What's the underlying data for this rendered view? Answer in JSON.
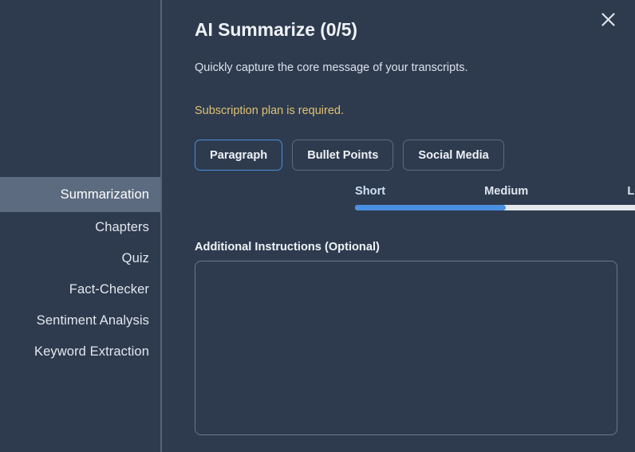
{
  "sidebar": {
    "items": [
      {
        "label": "Summarization",
        "active": true
      },
      {
        "label": "Chapters",
        "active": false
      },
      {
        "label": "Quiz",
        "active": false
      },
      {
        "label": "Fact-Checker",
        "active": false
      },
      {
        "label": "Sentiment Analysis",
        "active": false
      },
      {
        "label": "Keyword Extraction",
        "active": false
      }
    ]
  },
  "panel": {
    "title": "AI Summarize (0/5)",
    "subtitle": "Quickly capture the core message of your transcripts.",
    "notice": "Subscription plan is required.",
    "notice_color": "#e0c073",
    "close_icon": "close-icon",
    "format_options": [
      {
        "label": "Paragraph",
        "selected": true
      },
      {
        "label": "Bullet Points",
        "selected": false
      },
      {
        "label": "Social Media",
        "selected": false
      }
    ],
    "length": {
      "options": [
        {
          "label": "Short",
          "active": true
        },
        {
          "label": "Medium",
          "active": false
        },
        {
          "label": "Long",
          "active": false
        }
      ],
      "fill_percent": "50%",
      "fill_color": "#4a90e2",
      "track_color": "#e3e6ea"
    },
    "instructions": {
      "label": "Additional Instructions (Optional)",
      "value": "",
      "placeholder": ""
    },
    "accent_color": "#4a90d9"
  }
}
